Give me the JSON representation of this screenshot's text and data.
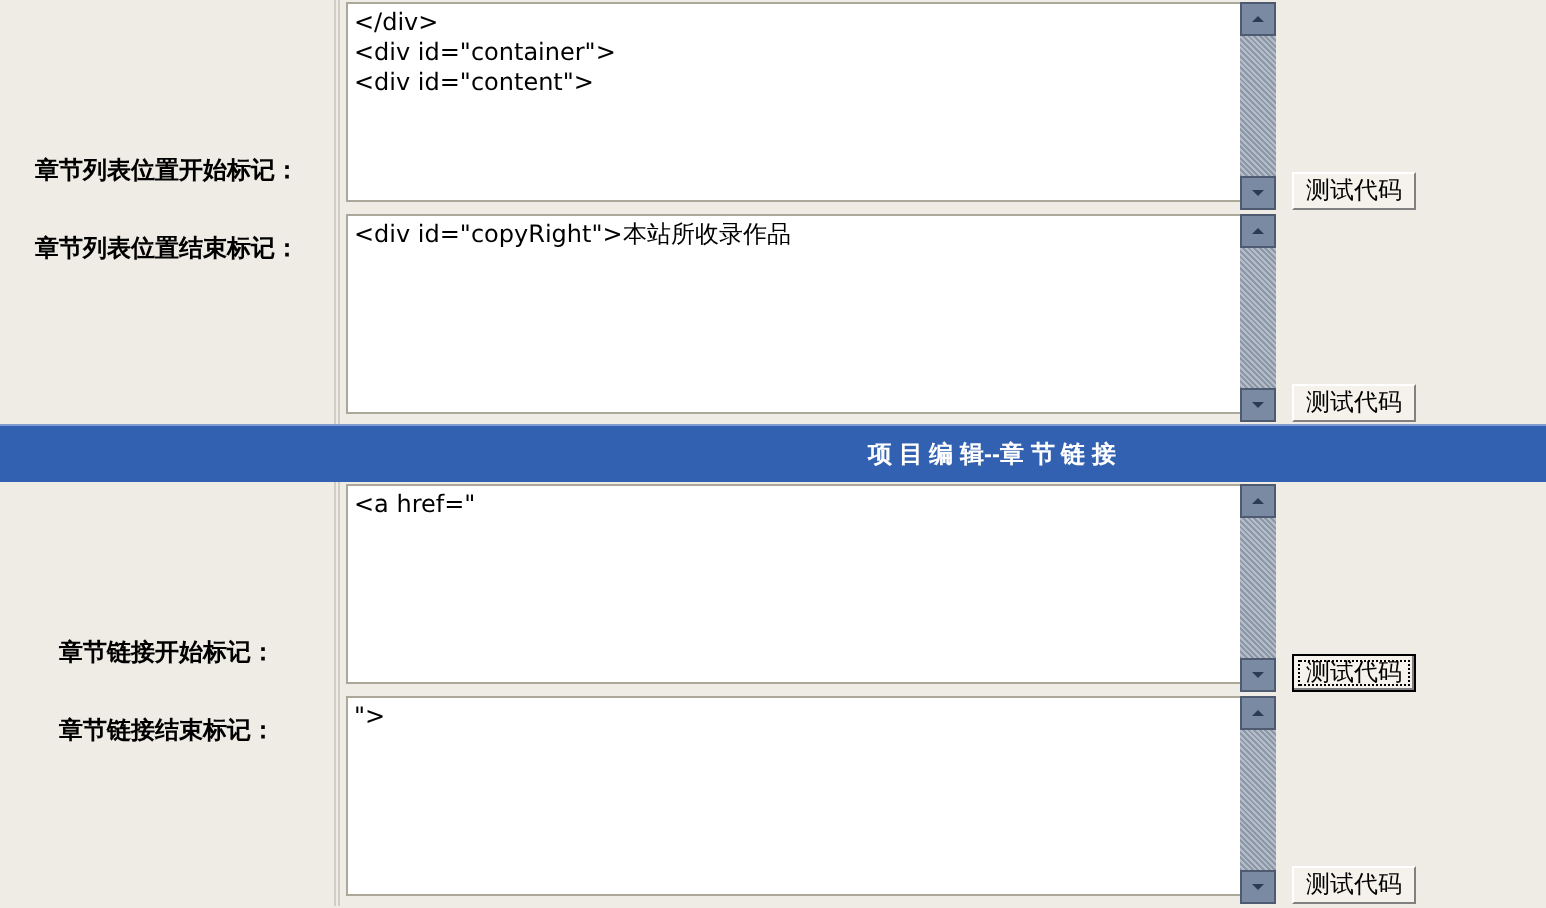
{
  "rows_top": [
    {
      "label": "章节列表位置开始标记：",
      "value": "</div>\n<div id=\"container\">\n<div id=\"content\">",
      "button": {
        "label": "测试代码",
        "focused": false
      }
    },
    {
      "label": "章节列表位置结束标记：",
      "value": "<div id=\"copyRight\">本站所收录作品",
      "button": {
        "label": "测试代码",
        "focused": false
      }
    }
  ],
  "section_bar": {
    "title": "项 目 编 辑--章 节 链 接"
  },
  "rows_bottom": [
    {
      "label": "章节链接开始标记：",
      "value": "<a href=\"",
      "button": {
        "label": "测试代码",
        "focused": true
      }
    },
    {
      "label": "章节链接结束标记：",
      "value": "\">",
      "button": {
        "label": "测试代码",
        "focused": false
      }
    }
  ]
}
